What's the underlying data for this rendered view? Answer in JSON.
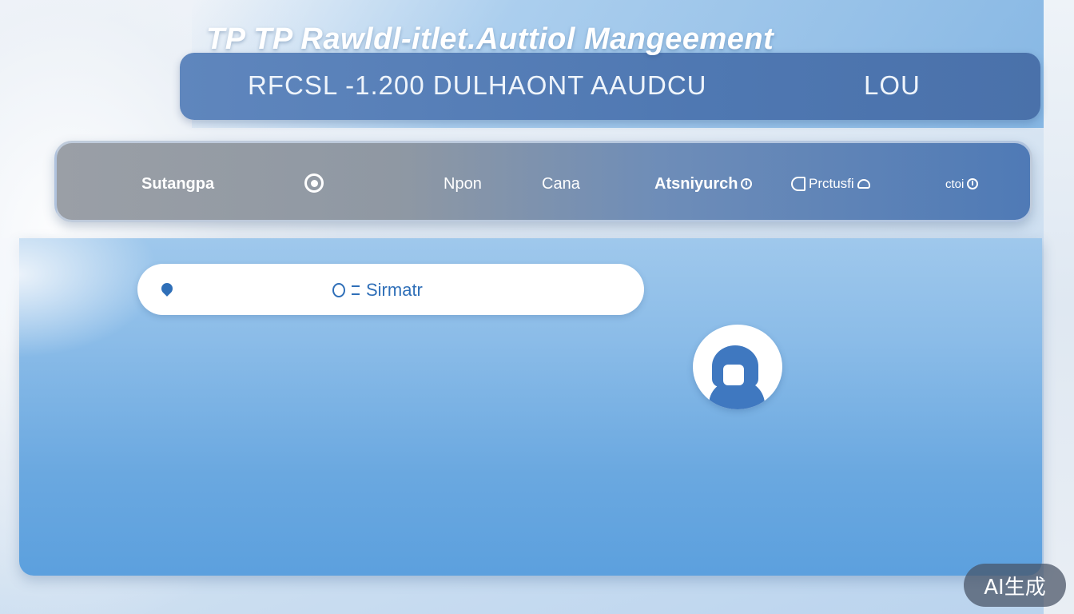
{
  "app": {
    "title": "TP TP Rawldl-itlet.Auttiol Mangeement"
  },
  "banner": {
    "left_text": "RFCSL  -1.200  DULHAONT AAUDCU",
    "right_text": "LOU"
  },
  "nav": {
    "items": [
      {
        "label": "Sutangpa"
      },
      {
        "label": "Npon"
      },
      {
        "label": "Cana"
      },
      {
        "label": "Atsniyurch"
      },
      {
        "label": "Prctusfi"
      },
      {
        "label": "ctoi"
      }
    ],
    "icons": [
      "record-icon",
      "settings-icon",
      "toggle-icon",
      "cloud-icon",
      "info-icon"
    ]
  },
  "search": {
    "text": "Sirmatr",
    "icons": [
      "location-pin-icon",
      "ring-icon",
      "equals-icon"
    ]
  },
  "avatar": {
    "icon": "user-avatar-icon"
  },
  "badge": {
    "label": "AI生成"
  },
  "colors": {
    "banner": "#5f86bd",
    "nav_left": "#9a9fa6",
    "nav_right": "#4f7ab6",
    "panel": "#6aa8e0",
    "accent": "#2f6fb8",
    "badge_bg": "#465264"
  }
}
